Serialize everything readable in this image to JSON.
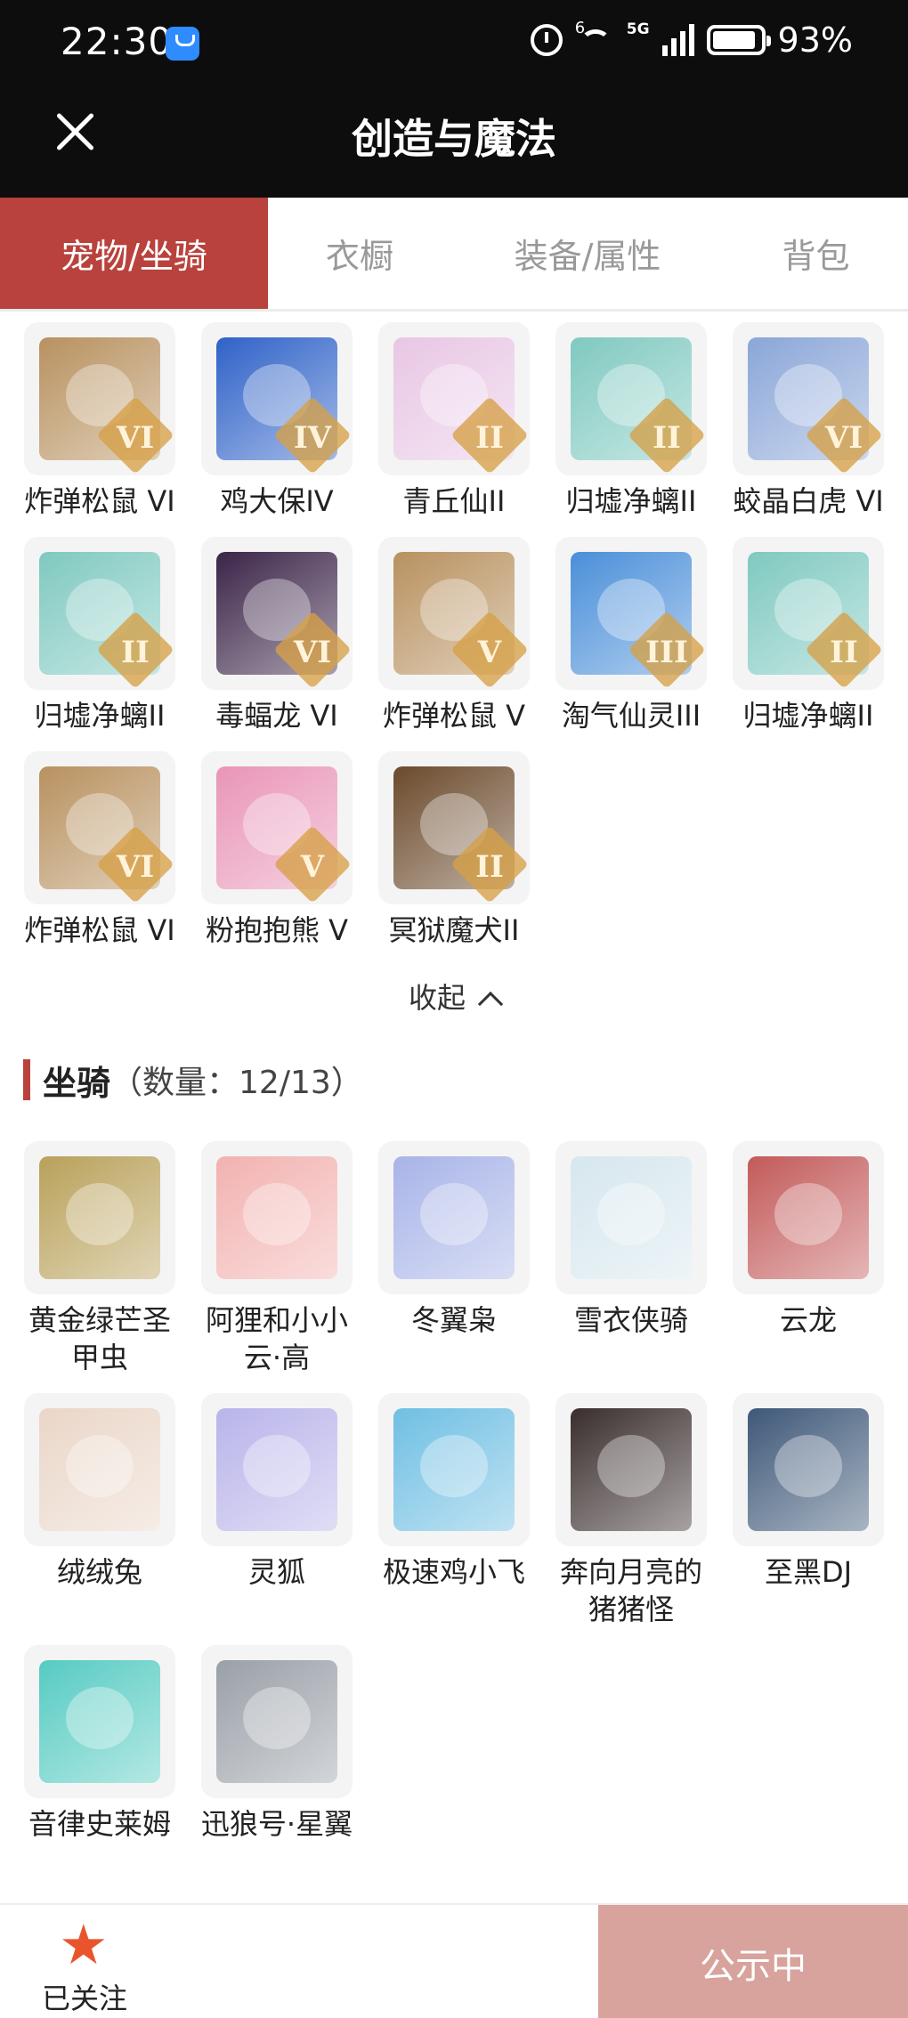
{
  "status_bar": {
    "time": "22:30",
    "battery": "93%",
    "wifi_badge": "6",
    "network": "5G"
  },
  "nav": {
    "title": "创造与魔法"
  },
  "tabs": [
    {
      "label": "宠物/坐骑",
      "active": true
    },
    {
      "label": "衣橱",
      "active": false
    },
    {
      "label": "装备/属性",
      "active": false
    },
    {
      "label": "背包",
      "active": false
    }
  ],
  "pets": [
    {
      "name": "炸弹松鼠 VI",
      "badge": "VI",
      "color": "#b8915f"
    },
    {
      "name": "鸡大保IV",
      "badge": "IV",
      "color": "#2f62c8"
    },
    {
      "name": "青丘仙II",
      "badge": "II",
      "color": "#e8c6e4"
    },
    {
      "name": "归墟净螭II",
      "badge": "II",
      "color": "#7fc9c0"
    },
    {
      "name": "蛟晶白虎 VI",
      "badge": "VI",
      "color": "#8aa6d8"
    },
    {
      "name": "归墟净螭II",
      "badge": "II",
      "color": "#7fc9c0"
    },
    {
      "name": "毒蝠龙 VI",
      "badge": "VI",
      "color": "#3b2448"
    },
    {
      "name": "炸弹松鼠 V",
      "badge": "V",
      "color": "#b8915f"
    },
    {
      "name": "淘气仙灵III",
      "badge": "III",
      "color": "#4a8fd9"
    },
    {
      "name": "归墟净螭II",
      "badge": "II",
      "color": "#7fc9c0"
    },
    {
      "name": "炸弹松鼠 VI",
      "badge": "VI",
      "color": "#b8915f"
    },
    {
      "name": "粉抱抱熊 V",
      "badge": "V",
      "color": "#e995b8"
    },
    {
      "name": "冥狱魔犬II",
      "badge": "II",
      "color": "#6b4a2c"
    }
  ],
  "collapse_label": "收起",
  "mounts_section": {
    "title": "坐骑",
    "count": "（数量：12/13）"
  },
  "mounts": [
    {
      "name": "黄金绿芒圣甲虫",
      "color": "#b9a15a"
    },
    {
      "name": "阿狸和小小云·高",
      "color": "#f2b2b0"
    },
    {
      "name": "冬翼枭",
      "color": "#a8b4e8"
    },
    {
      "name": "雪衣侠骑",
      "color": "#d6e7ee"
    },
    {
      "name": "云龙",
      "color": "#c35a5a"
    },
    {
      "name": "绒绒兔",
      "color": "#ead6c8"
    },
    {
      "name": "灵狐",
      "color": "#b9b4ea"
    },
    {
      "name": "极速鸡小飞",
      "color": "#6fbfe3"
    },
    {
      "name": "奔向月亮的猪猪怪",
      "color": "#3a2e2e"
    },
    {
      "name": "至黑DJ",
      "color": "#3e5878"
    },
    {
      "name": "音律史莱姆",
      "color": "#56cbc2"
    },
    {
      "name": "迅狼号·星翼",
      "color": "#9aa0a8"
    }
  ],
  "bottom": {
    "follow_label": "已关注",
    "public_label": "公示中"
  },
  "colors": {
    "accent": "#b9423d",
    "public_button": "#d8a29d",
    "star": "#e8552d"
  }
}
